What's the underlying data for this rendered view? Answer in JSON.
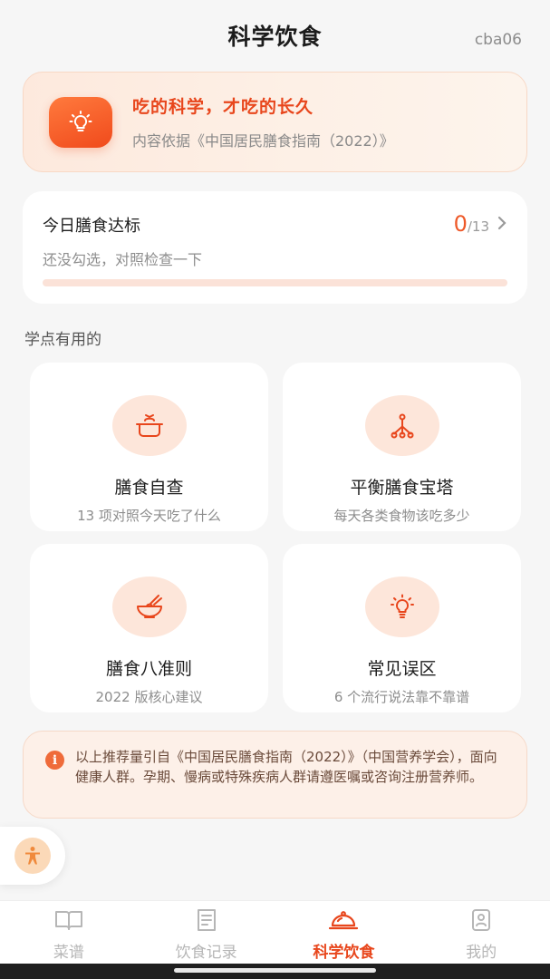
{
  "header": {
    "title": "科学饮食",
    "user": "cba06"
  },
  "banner": {
    "icon": "lightbulb-icon",
    "headline": "吃的科学，才吃的长久",
    "source": "内容依据《中国居民膳食指南（2022）》"
  },
  "progress": {
    "label": "今日膳食达标",
    "done": "0",
    "total": "/13",
    "hint": "还没勾选，对照检查一下",
    "fraction": 0
  },
  "section": {
    "title": "学点有用的"
  },
  "cards": [
    {
      "icon": "cooking-pot-icon",
      "name": "膳食自查",
      "desc": "13 项对照今天吃了什么"
    },
    {
      "icon": "pyramid-tree-icon",
      "name": "平衡膳食宝塔",
      "desc": "每天各类食物该吃多少"
    },
    {
      "icon": "bowl-chopsticks-icon",
      "name": "膳食八准则",
      "desc": "2022 版核心建议"
    },
    {
      "icon": "warning-bulb-icon",
      "name": "常见误区",
      "desc": "6 个流行说法靠不靠谱"
    }
  ],
  "notice": {
    "text": "以上推荐量引自《中国居民膳食指南（2022）》（中国营养学会），面向健康人群。孕期、慢病或特殊疾病人群请遵医嘱或咨询注册营养师。"
  },
  "tabs": [
    {
      "label": "菜谱",
      "icon": "book-icon",
      "active": false
    },
    {
      "label": "饮食记录",
      "icon": "notes-icon",
      "active": false
    },
    {
      "label": "科学饮食",
      "icon": "food-cloche-icon",
      "active": true
    },
    {
      "label": "我的",
      "icon": "profile-icon",
      "active": false
    }
  ],
  "colors": {
    "accent": "#e8461c",
    "accent_soft": "#fde6da",
    "background": "#f6f6f6"
  }
}
